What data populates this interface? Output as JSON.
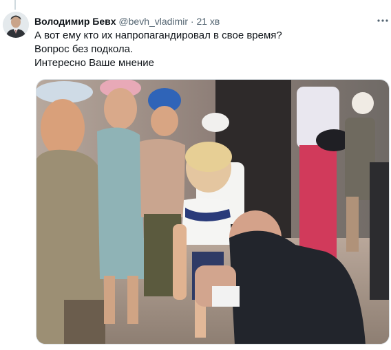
{
  "tweet": {
    "author": {
      "display_name": "Володимир Бевх",
      "handle": "@bevh_vladimir",
      "avatar_icon": "avatar-portrait-icon"
    },
    "separator": "·",
    "timestamp": "21 хв",
    "more_icon": "more-horizontal-icon",
    "text_lines": [
      "А вот ему кто их напропагандировал в свое время?",
      "Вопрос без подкола.",
      "Интересно Ваше мнение"
    ],
    "media": {
      "type": "photo"
    }
  },
  "colors": {
    "text_primary": "#0f1419",
    "text_secondary": "#536471",
    "border": "#d9dfe3",
    "thread_line": "#cfd9de"
  }
}
